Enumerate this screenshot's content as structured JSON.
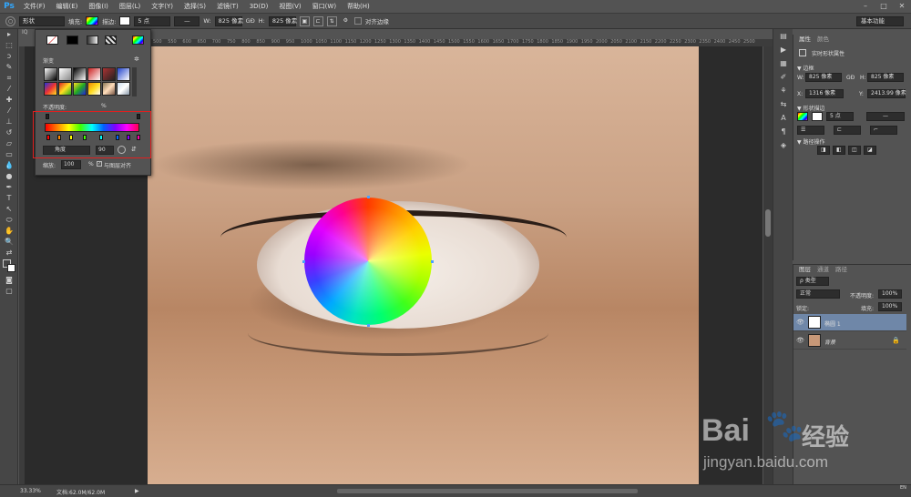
{
  "menu": {
    "logo": "Ps",
    "items": [
      "文件(F)",
      "编辑(E)",
      "图像(I)",
      "图层(L)",
      "文字(Y)",
      "选择(S)",
      "滤镜(T)",
      "3D(D)",
      "视图(V)",
      "窗口(W)",
      "帮助(H)"
    ],
    "minimize": "–",
    "maximize": "□",
    "close": "✕"
  },
  "options": {
    "shape_mode": "形状",
    "fill_label": "填充:",
    "stroke_label": "描边:",
    "stroke_size": "5 点",
    "w_label": "W:",
    "w_value": "825 像素",
    "link": "GĐ",
    "h_label": "H:",
    "h_value": "825 像素",
    "align_edges": "对齐边缘",
    "workspace": "基本功能"
  },
  "doc_tab": "IQ",
  "ruler_ticks": [
    "500",
    "550",
    "600",
    "650",
    "700",
    "750",
    "800",
    "850",
    "900",
    "950",
    "1000",
    "1050",
    "1100",
    "1150",
    "1200",
    "1250",
    "1300",
    "1350",
    "1400",
    "1450",
    "1500",
    "1550",
    "1600",
    "1650",
    "1700",
    "1750",
    "1800",
    "1850",
    "1900",
    "1950",
    "2000",
    "2050",
    "2100",
    "2150",
    "2200",
    "2250",
    "2300",
    "2350",
    "2400",
    "2450",
    "2500"
  ],
  "gradient_panel": {
    "section_label": "渐变",
    "opacity_label": "不透明度:",
    "opacity_unit": "%",
    "style_label": "角度",
    "angle_value": "90",
    "scale_label": "缩放:",
    "scale_value": "100",
    "scale_unit": "%",
    "align_layer": "与图层对齐"
  },
  "properties": {
    "tab_properties": "属性",
    "tab_color": "颜色",
    "title": "实时形状属性",
    "section_transform": "▼ 边框",
    "w_label": "W:",
    "w_value": "825 像素",
    "link": "GĐ",
    "h_label": "H:",
    "h_value": "825 像素",
    "x_label": "X:",
    "x_value": "1316 像素",
    "y_label": "Y:",
    "y_value": "2413.99 像素",
    "section_appearance": "▼ 形状描边",
    "stroke_size": "5 点",
    "section_path": "▼ 路径操作"
  },
  "layers": {
    "tab_layers": "图层",
    "tab_channels": "通道",
    "tab_paths": "路径",
    "filter_label": "ρ 类型",
    "blend_mode": "正常",
    "opacity_label": "不透明度:",
    "opacity_value": "100%",
    "lock_label": "锁定:",
    "fill_label": "填充:",
    "fill_value": "100%",
    "rows": [
      {
        "name": "椭圆 1",
        "selected": true
      },
      {
        "name": "背景",
        "selected": false
      }
    ]
  },
  "status": {
    "zoom": "33.33%",
    "doc_info": "文档:62.0M/62.0M",
    "arrow": "▶"
  },
  "watermark": {
    "brand": "Bai",
    "brand_cn": "经验",
    "url": "jingyan.baidu.com"
  },
  "lang_indicator": "EN"
}
